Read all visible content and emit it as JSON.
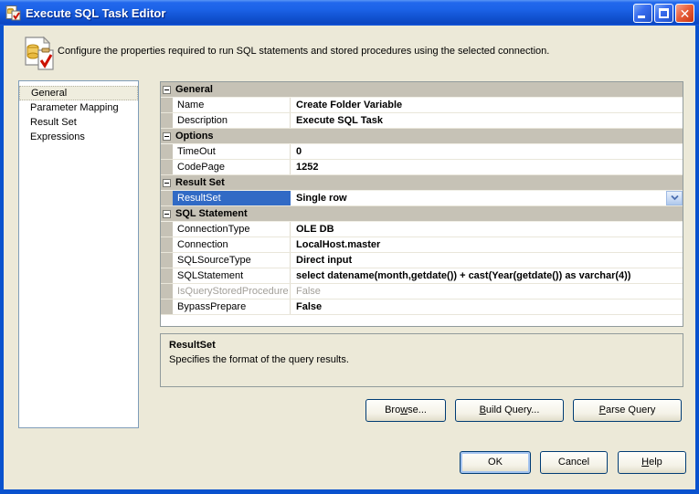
{
  "window": {
    "title": "Execute SQL Task Editor",
    "caption_buttons": {
      "minimize": "minimize",
      "maximize": "maximize",
      "close": "close"
    }
  },
  "banner": {
    "description": "Configure the properties required to run SQL statements and stored procedures using the selected connection."
  },
  "nav": {
    "items": [
      {
        "label": "General",
        "selected": true
      },
      {
        "label": "Parameter Mapping",
        "selected": false
      },
      {
        "label": "Result Set",
        "selected": false
      },
      {
        "label": "Expressions",
        "selected": false
      }
    ]
  },
  "grid": {
    "sections": [
      {
        "label": "General",
        "rows": [
          {
            "name": "Name",
            "value": "Create Folder Variable"
          },
          {
            "name": "Description",
            "value": "Execute SQL Task"
          }
        ]
      },
      {
        "label": "Options",
        "rows": [
          {
            "name": "TimeOut",
            "value": "0"
          },
          {
            "name": "CodePage",
            "value": "1252"
          }
        ]
      },
      {
        "label": "Result Set",
        "rows": [
          {
            "name": "ResultSet",
            "value": "Single row",
            "selected": true,
            "has_dropdown": true
          }
        ]
      },
      {
        "label": "SQL Statement",
        "rows": [
          {
            "name": "ConnectionType",
            "value": "OLE DB"
          },
          {
            "name": "Connection",
            "value": "LocalHost.master"
          },
          {
            "name": "SQLSourceType",
            "value": "Direct input"
          },
          {
            "name": "SQLStatement",
            "value": "select datename(month,getdate()) + cast(Year(getdate()) as varchar(4))"
          },
          {
            "name": "IsQueryStoredProcedure",
            "value": "False",
            "disabled": true
          },
          {
            "name": "BypassPrepare",
            "value": "False"
          }
        ]
      }
    ]
  },
  "help": {
    "title": "ResultSet",
    "text": "Specifies the format of the query results."
  },
  "buttons": {
    "browse": {
      "pre": "Bro",
      "key": "w",
      "post": "se..."
    },
    "build_query": {
      "pre": "",
      "key": "B",
      "post": "uild Query..."
    },
    "parse_query": {
      "pre": "",
      "key": "P",
      "post": "arse Query"
    },
    "ok": {
      "label": "OK"
    },
    "cancel": {
      "label": "Cancel"
    },
    "help": {
      "pre": "",
      "key": "H",
      "post": "elp"
    }
  },
  "colors": {
    "titlebar_blue": "#1C63E8",
    "selection_blue": "#316AC5",
    "dialog_background": "#ECE9D8",
    "category_gray": "#C6C2B6",
    "close_red": "#E8603C"
  }
}
